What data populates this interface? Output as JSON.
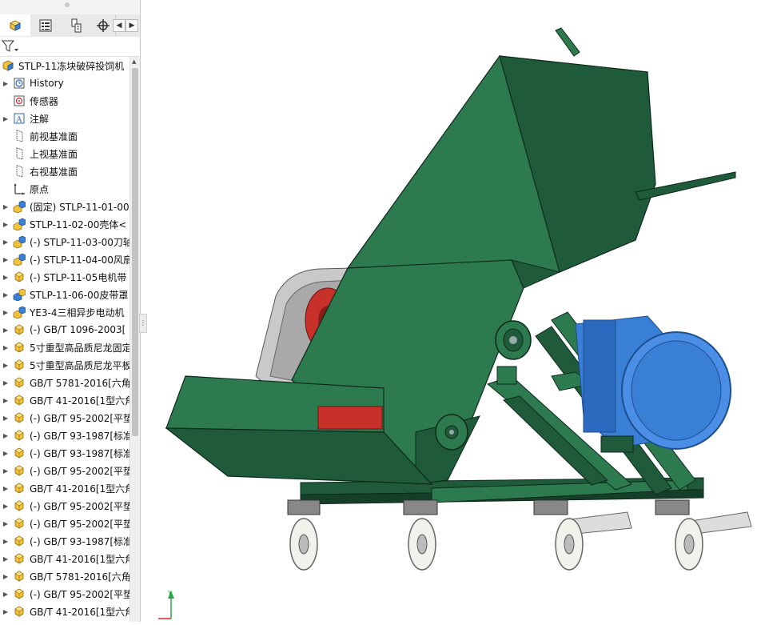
{
  "tree": {
    "root_label": "STLP-11冻块破碎投饲机",
    "items": [
      {
        "label": "History",
        "icon": "history-icon",
        "expand": true
      },
      {
        "label": "传感器",
        "icon": "sensor-icon",
        "expand": false
      },
      {
        "label": "注解",
        "icon": "annotation-icon",
        "expand": true
      },
      {
        "label": "前视基准面",
        "icon": "plane-icon",
        "expand": false
      },
      {
        "label": "上视基准面",
        "icon": "plane-icon",
        "expand": false
      },
      {
        "label": "右视基准面",
        "icon": "plane-icon",
        "expand": false
      },
      {
        "label": "原点",
        "icon": "origin-icon",
        "expand": false
      },
      {
        "label": "(固定) STLP-11-01-00",
        "icon": "subassembly-icon",
        "expand": true
      },
      {
        "label": "STLP-11-02-00壳体<",
        "icon": "subassembly-icon",
        "expand": true
      },
      {
        "label": "(-) STLP-11-03-00刀轴",
        "icon": "subassembly-icon",
        "expand": true
      },
      {
        "label": "(-) STLP-11-04-00风扇",
        "icon": "subassembly-icon",
        "expand": true
      },
      {
        "label": "(-) STLP-11-05电机带",
        "icon": "part-icon",
        "expand": true
      },
      {
        "label": "STLP-11-06-00皮带罩",
        "icon": "subassembly-blue-icon",
        "expand": true
      },
      {
        "label": "YE3-4三相异步电动机",
        "icon": "subassembly-icon",
        "expand": true
      },
      {
        "label": "(-) GB/T 1096-2003[",
        "icon": "part-icon",
        "expand": true
      },
      {
        "label": "5寸重型高品质尼龙固定",
        "icon": "part-icon",
        "expand": true
      },
      {
        "label": "5寸重型高品质尼龙平板",
        "icon": "part-icon",
        "expand": true
      },
      {
        "label": "GB/T 5781-2016[六角",
        "icon": "part-icon",
        "expand": true
      },
      {
        "label": "GB/T 41-2016[1型六角",
        "icon": "part-icon",
        "expand": true
      },
      {
        "label": "(-) GB/T 95-2002[平垫",
        "icon": "part-icon",
        "expand": true
      },
      {
        "label": "(-) GB/T 93-1987[标准",
        "icon": "part-icon",
        "expand": true
      },
      {
        "label": "(-) GB/T 93-1987[标准",
        "icon": "part-icon",
        "expand": true
      },
      {
        "label": "(-) GB/T 95-2002[平垫",
        "icon": "part-icon",
        "expand": true
      },
      {
        "label": "GB/T 41-2016[1型六角",
        "icon": "part-icon",
        "expand": true
      },
      {
        "label": "(-) GB/T 95-2002[平垫",
        "icon": "part-icon",
        "expand": true
      },
      {
        "label": "(-) GB/T 95-2002[平垫",
        "icon": "part-icon",
        "expand": true
      },
      {
        "label": "(-) GB/T 93-1987[标准",
        "icon": "part-icon",
        "expand": true
      },
      {
        "label": "GB/T 41-2016[1型六角",
        "icon": "part-icon",
        "expand": true
      },
      {
        "label": "GB/T 5781-2016[六角",
        "icon": "part-icon",
        "expand": true
      },
      {
        "label": "(-) GB/T 95-2002[平垫",
        "icon": "part-icon",
        "expand": true
      },
      {
        "label": "GB/T 41-2016[1型六角",
        "icon": "part-icon",
        "expand": true
      }
    ]
  },
  "tabs": [
    {
      "name": "feature-manager-tab",
      "icon": "assembly-icon"
    },
    {
      "name": "property-manager-tab",
      "icon": "property-icon"
    },
    {
      "name": "configuration-manager-tab",
      "icon": "configuration-icon"
    },
    {
      "name": "dimxpert-tab",
      "icon": "dimxpert-icon"
    }
  ],
  "colors": {
    "machine_green": "#1f5a3a",
    "machine_green_light": "#2e7a4f",
    "motor_blue": "#3a7fd6",
    "drive_red": "#c8302a",
    "belt_guard_grey": "#b5b5b5",
    "caster_white": "#f2f2ec",
    "axis_red": "#d42a2a",
    "axis_green": "#2aa84a"
  }
}
